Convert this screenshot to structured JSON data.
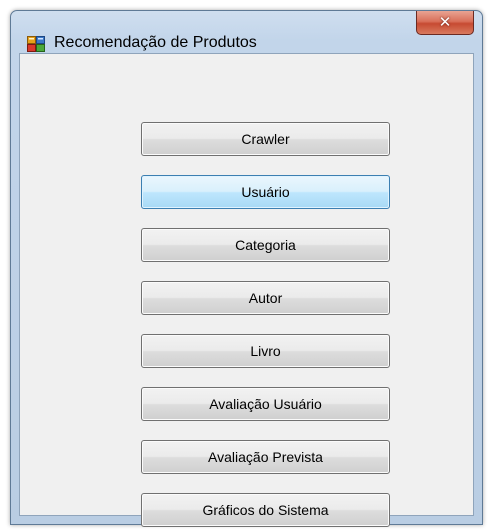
{
  "window": {
    "title": "Recomendação de Produtos",
    "icon": "application-form-icon",
    "close_label": "✕"
  },
  "buttons": [
    {
      "label": "Crawler",
      "focused": false
    },
    {
      "label": "Usuário",
      "focused": true
    },
    {
      "label": "Categoria",
      "focused": false
    },
    {
      "label": "Autor",
      "focused": false
    },
    {
      "label": "Livro",
      "focused": false
    },
    {
      "label": "Avaliação Usuário",
      "focused": false
    },
    {
      "label": "Avaliação Prevista",
      "focused": false
    },
    {
      "label": "Gráficos do Sistema",
      "focused": false
    }
  ],
  "colors": {
    "frame": "#c2d5ea",
    "client": "#f0f0f0",
    "close_button": "#c74a32",
    "focus_border": "#3c7fb1"
  }
}
